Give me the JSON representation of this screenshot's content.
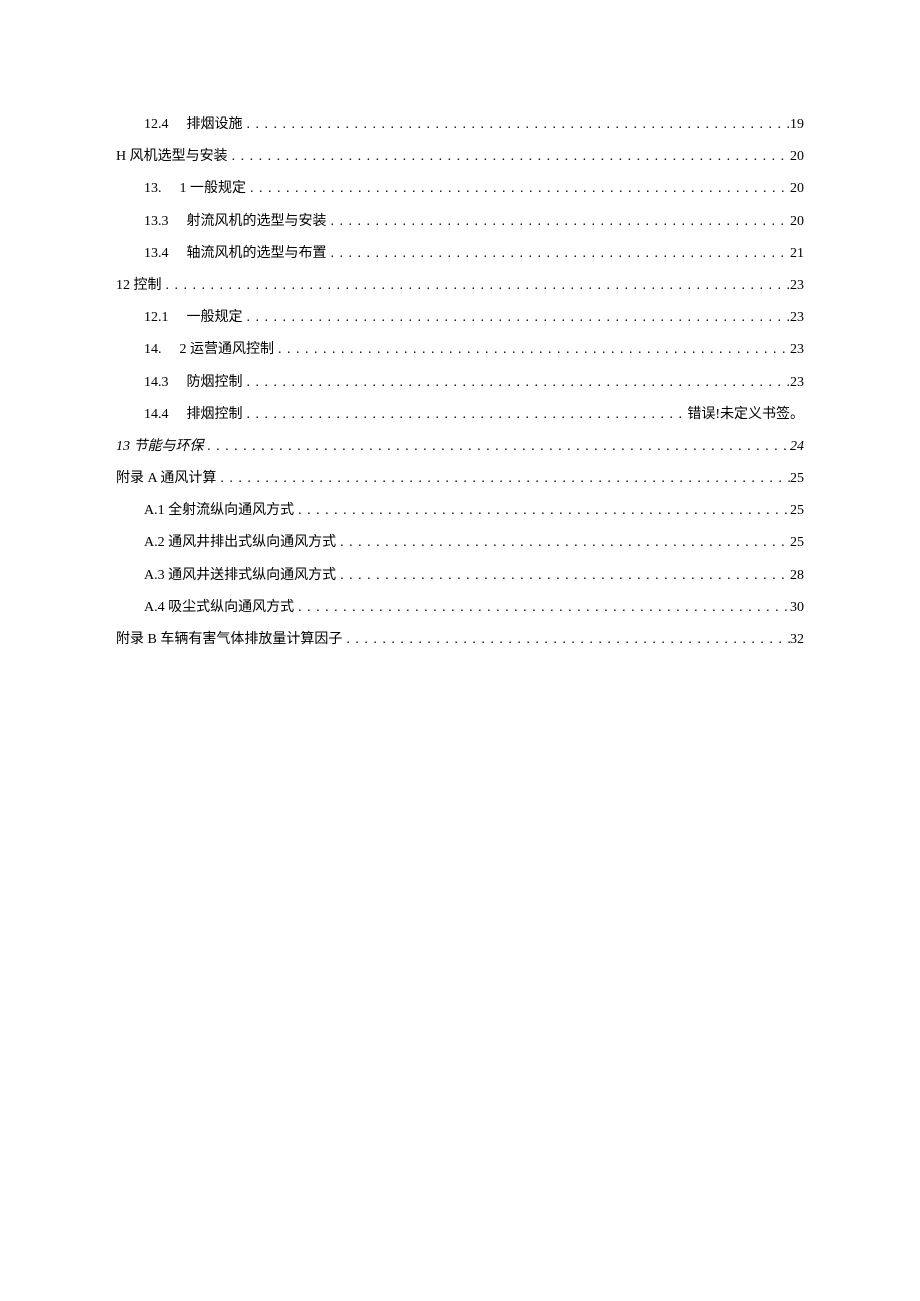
{
  "dots": ". . . . . . . . . . . . . . . . . . . . . . . . . . . . . . . . . . . . . . . . . . . . . . . . . . . . . . . . . . . . . . . . . . . . . . . . . . . . . . . . . . . . . . . . . . . . . . . . . . . . . . . . . . . . . . . . . . . . . . . . . . . . . . . . . . . . . . . . . . . . . . . . . . . . . . . . . . . . . . . . . . . . . . . . . . . . . . . . . . . . . . . . . . . . . . . . . . . . . . . . . . . . . . . . . . . . . . . . . . . . . . . . . . . . . .",
  "entries": [
    {
      "indent": 1,
      "num": "12.4",
      "title": "排烟设施",
      "page": "19",
      "italic": false
    },
    {
      "indent": 0,
      "num": "",
      "title": "H 风机选型与安装",
      "page": "20",
      "italic": false
    },
    {
      "indent": 1,
      "num": "13.",
      "title": "1 一般规定",
      "page": "20",
      "italic": false
    },
    {
      "indent": 1,
      "num": "13.3",
      "title": "射流风机的选型与安装",
      "page": "20",
      "italic": false
    },
    {
      "indent": 1,
      "num": "13.4",
      "title": "轴流风机的选型与布置",
      "page": "21",
      "italic": false
    },
    {
      "indent": 0,
      "num": "",
      "title": "12 控制",
      "page": "23",
      "italic": false
    },
    {
      "indent": 1,
      "num": "12.1",
      "title": "一般规定",
      "page": "23",
      "italic": false
    },
    {
      "indent": 1,
      "num": "14.",
      "title": "2 运营通风控制",
      "page": "23",
      "italic": false
    },
    {
      "indent": 1,
      "num": "14.3",
      "title": "防烟控制",
      "page": "23",
      "italic": false
    },
    {
      "indent": 1,
      "num": "14.4",
      "title": "排烟控制",
      "page": "错误!未定义书签。",
      "italic": false
    },
    {
      "indent": 0,
      "num": "",
      "title": "13 节能与环保",
      "page": "24",
      "italic": true
    },
    {
      "indent": 0,
      "num": "",
      "title": "附录 A 通风计算",
      "page": "25",
      "italic": false
    },
    {
      "indent": 1,
      "num": "",
      "title": "A.1 全射流纵向通风方式",
      "page": "25",
      "italic": false
    },
    {
      "indent": 1,
      "num": "",
      "title": "A.2 通风井排出式纵向通风方式",
      "page": "25",
      "italic": false
    },
    {
      "indent": 1,
      "num": "",
      "title": "A.3 通风井送排式纵向通风方式",
      "page": "28",
      "italic": false
    },
    {
      "indent": 1,
      "num": "",
      "title": "A.4 吸尘式纵向通风方式",
      "page": "30",
      "italic": false
    },
    {
      "indent": 0,
      "num": "",
      "title": "附录 B 车辆有害气体排放量计算因子",
      "page": "32",
      "italic": false
    }
  ]
}
